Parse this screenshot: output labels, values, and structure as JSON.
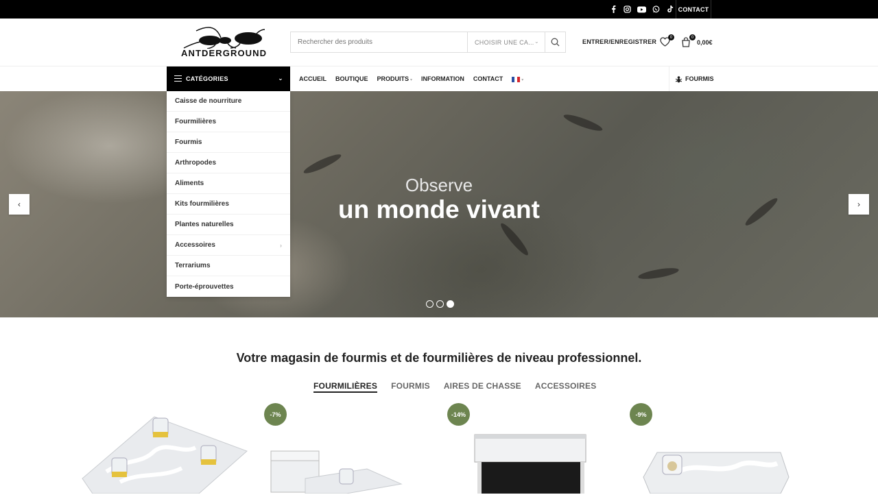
{
  "topbar": {
    "social_icons": [
      "facebook-icon",
      "instagram-icon",
      "youtube-icon",
      "whatsapp-icon",
      "tiktok-icon"
    ],
    "contact_label": "CONTACT"
  },
  "header": {
    "logo_text": "ANTDERGROUND",
    "search_placeholder": "Rechercher des produits",
    "category_select": "CHOISIR UNE CA...",
    "login_label": "ENTRER/ENREGISTRER",
    "wishlist_count": "0",
    "cart_count": "0",
    "cart_total": "0,00€"
  },
  "nav": {
    "categories_label": "CATÉGORIES",
    "items": [
      "ACCUEIL",
      "BOUTIQUE",
      "PRODUITS",
      "INFORMATION",
      "CONTACT"
    ],
    "right_link": "FOURMIS"
  },
  "categories": [
    "Caisse de nourriture",
    "Fourmilières",
    "Fourmis",
    "Arthropodes",
    "Aliments",
    "Kits fourmilières",
    "Plantes naturelles",
    "Accessoires",
    "Terrariums",
    "Porte-éprouvettes"
  ],
  "hero": {
    "subtitle": "Observe",
    "title": "un monde vivant",
    "slides": 3,
    "active_slide": 3
  },
  "content": {
    "heading": "Votre magasin de fourmis et de fourmilières de niveau professionnel.",
    "tabs": [
      "FOURMILIÈRES",
      "FOURMIS",
      "AIRES DE CHASSE",
      "ACCESSOIRES"
    ]
  },
  "products": [
    {
      "badge": ""
    },
    {
      "badge": "-7%"
    },
    {
      "badge": "-14%"
    },
    {
      "badge": "-9%"
    }
  ],
  "colors": {
    "accent_badge": "#6d8550",
    "topbar": "#000000"
  }
}
